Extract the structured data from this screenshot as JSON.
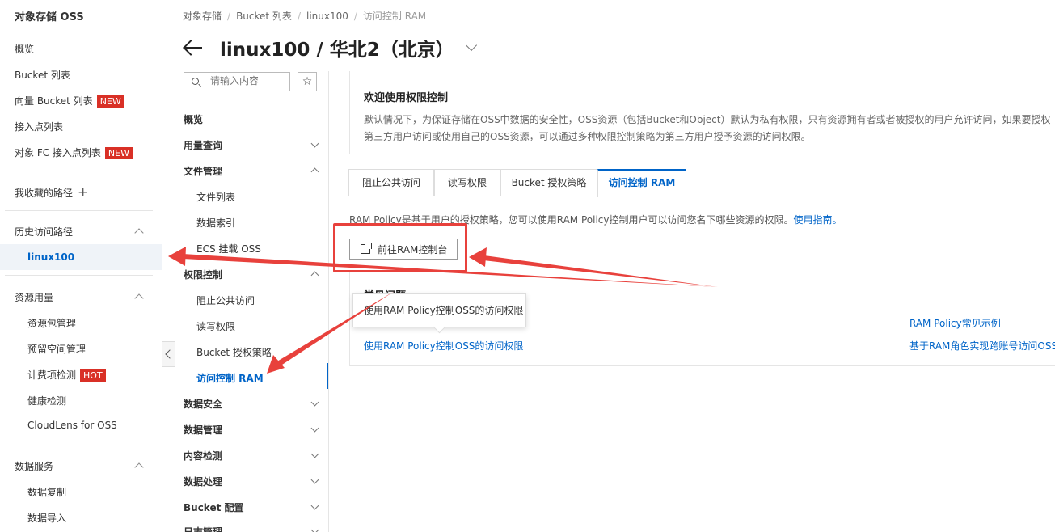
{
  "sidebar": {
    "title": "对象存储 OSS",
    "overview": "概览",
    "bucket_list": "Bucket 列表",
    "vector_bucket_list": "向量 Bucket 列表",
    "access_point_list": "接入点列表",
    "fc_access_point_list": "对象 FC 接入点列表",
    "badge_new": "NEW",
    "favorites": "我收藏的路径",
    "history_title": "历史访问路径",
    "history_item": "linux100",
    "resource_title": "资源用量",
    "resource_pack": "资源包管理",
    "reserved_space": "预留空间管理",
    "billing_check": "计费项检测",
    "badge_hot": "HOT",
    "health_check": "健康检测",
    "cloudlens": "CloudLens for OSS",
    "data_service_title": "数据服务",
    "data_replication": "数据复制",
    "data_import": "数据导入"
  },
  "breadcrumb": {
    "items": [
      "对象存储",
      "Bucket 列表",
      "linux100"
    ],
    "current": "访问控制 RAM"
  },
  "header": {
    "title": "linux100 / 华北2（北京）"
  },
  "subnav": {
    "search_placeholder": "请输入内容",
    "star": "☆",
    "overview": "概览",
    "usage_query": "用量查询",
    "file_mgmt": "文件管理",
    "file_list": "文件列表",
    "data_index": "数据索引",
    "ecs_mount": "ECS 挂载 OSS",
    "permission_ctrl": "权限控制",
    "block_public": "阻止公共访问",
    "rw_permission": "读写权限",
    "bucket_policy": "Bucket 授权策略",
    "access_ram": "访问控制 RAM",
    "data_security": "数据安全",
    "data_mgmt": "数据管理",
    "content_detect": "内容检测",
    "data_process": "数据处理",
    "bucket_config": "Bucket 配置",
    "log_mgmt": "日志管理"
  },
  "welcome": {
    "title": "欢迎使用权限控制",
    "desc": "默认情况下，为保证存储在OSS中数据的安全性，OSS资源（包括Bucket和Object）默认为私有权限，只有资源拥有者或者被授权的用户允许访问，如果要授权第三方用户访问或使用自己的OSS资源，可以通过多种权限控制策略为第三方用户授予资源的访问权限。"
  },
  "tabs": [
    "阻止公共访问",
    "读写权限",
    "Bucket 授权策略",
    "访问控制 RAM"
  ],
  "ram": {
    "desc": "RAM Policy是基于用户的授权策略，您可以使用RAM Policy控制用户可以访问您名下哪些资源的权限。",
    "guide_link": "使用指南。",
    "goto_button": "前往RAM控制台"
  },
  "faq": {
    "title": "常见问题",
    "link_left": "使用RAM Policy控制OSS的访问权限",
    "link_right_1": "RAM Policy常见示例",
    "link_right_2": "基于RAM角色实现跨账号访问OSS"
  },
  "tooltip": "使用RAM Policy控制OSS的访问权限",
  "colors": {
    "accent": "#0064c8",
    "annotation": "#e8413c",
    "badge": "#d93026"
  }
}
